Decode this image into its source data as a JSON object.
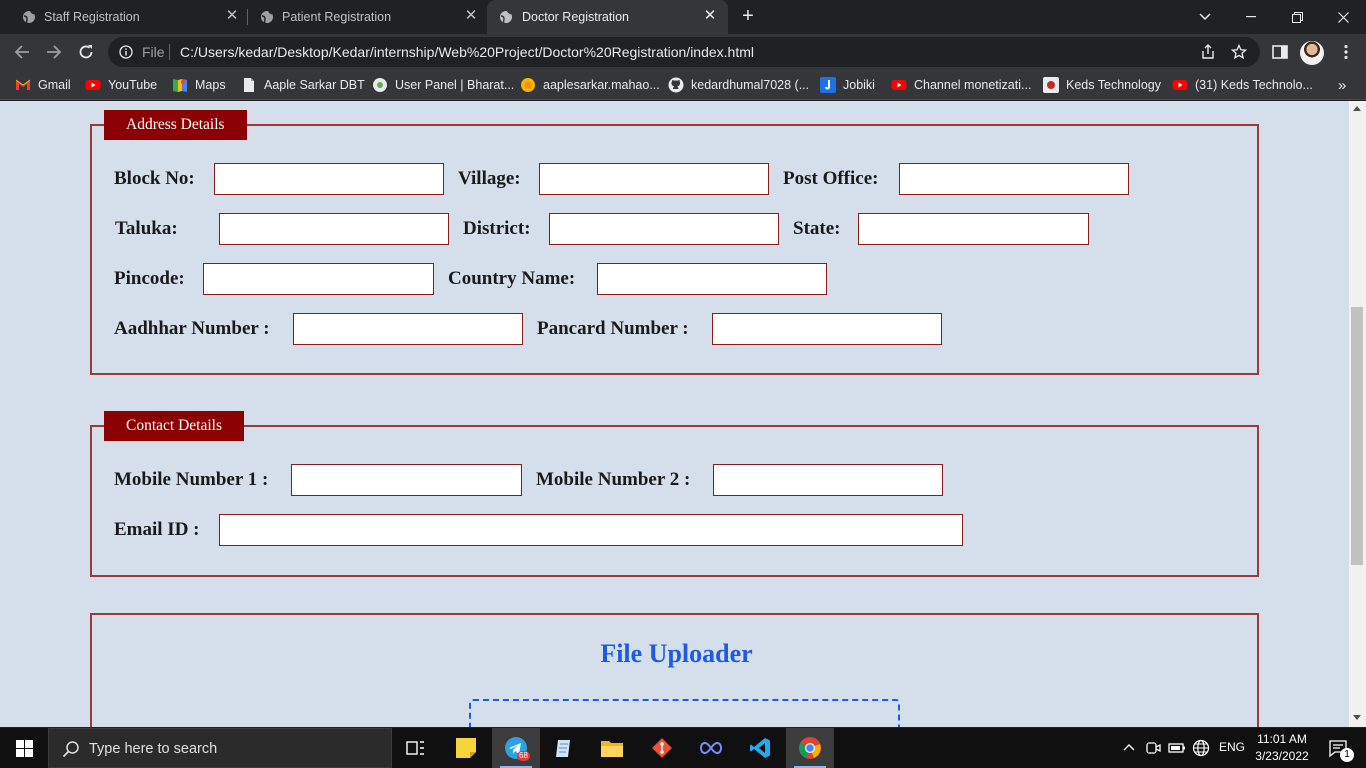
{
  "browser": {
    "tabs": [
      {
        "title": "Staff Registration",
        "active": false
      },
      {
        "title": "Patient Registration",
        "active": false
      },
      {
        "title": "Doctor Registration",
        "active": true
      }
    ],
    "omnibox": {
      "scheme_label": "File",
      "url": "C:/Users/kedar/Desktop/Kedar/internship/Web%20Project/Doctor%20Registration/index.html"
    },
    "bookmarks": [
      {
        "label": "Gmail",
        "icon": "gmail-icon"
      },
      {
        "label": "YouTube",
        "icon": "youtube-icon"
      },
      {
        "label": "Maps",
        "icon": "maps-icon"
      },
      {
        "label": "Aaple Sarkar DBT",
        "icon": "document-icon"
      },
      {
        "label": "User Panel | Bharat...",
        "icon": "emblem-icon"
      },
      {
        "label": "aaplesarkar.mahao...",
        "icon": "sun-icon"
      },
      {
        "label": "kedardhumal7028 (...",
        "icon": "github-icon"
      },
      {
        "label": "Jobiki",
        "icon": "jobiki-icon"
      },
      {
        "label": "Channel monetizati...",
        "icon": "youtube-icon"
      },
      {
        "label": "Keds Technology",
        "icon": "keds-icon"
      },
      {
        "label": "(31) Keds Technolo...",
        "icon": "youtube-icon"
      }
    ]
  },
  "form": {
    "address": {
      "legend": "Address Details",
      "block_no": "Block No:",
      "village": "Village:",
      "post_office": "Post Office:",
      "taluka": "Taluka:",
      "district": "District:",
      "state": "State:",
      "pincode": "Pincode:",
      "country": "Country Name:",
      "aadhar": "Aadhhar Number :",
      "pancard": "Pancard Number :"
    },
    "contact": {
      "legend": "Contact Details",
      "mobile1": "Mobile Number 1 :",
      "mobile2": "Mobile Number 2 :",
      "email": "Email ID :"
    },
    "uploader": {
      "title": "File Uploader"
    },
    "colors": {
      "page_bg": "#d5dfec",
      "legend_bg": "#8b0000",
      "border": "#9b3a3a",
      "uploader_accent": "#1e5be0"
    }
  },
  "taskbar": {
    "search_placeholder": "Type here to search",
    "telegram_badge": "68",
    "language": "ENG",
    "time": "11:01 AM",
    "date": "3/23/2022",
    "notification_count": "1"
  }
}
